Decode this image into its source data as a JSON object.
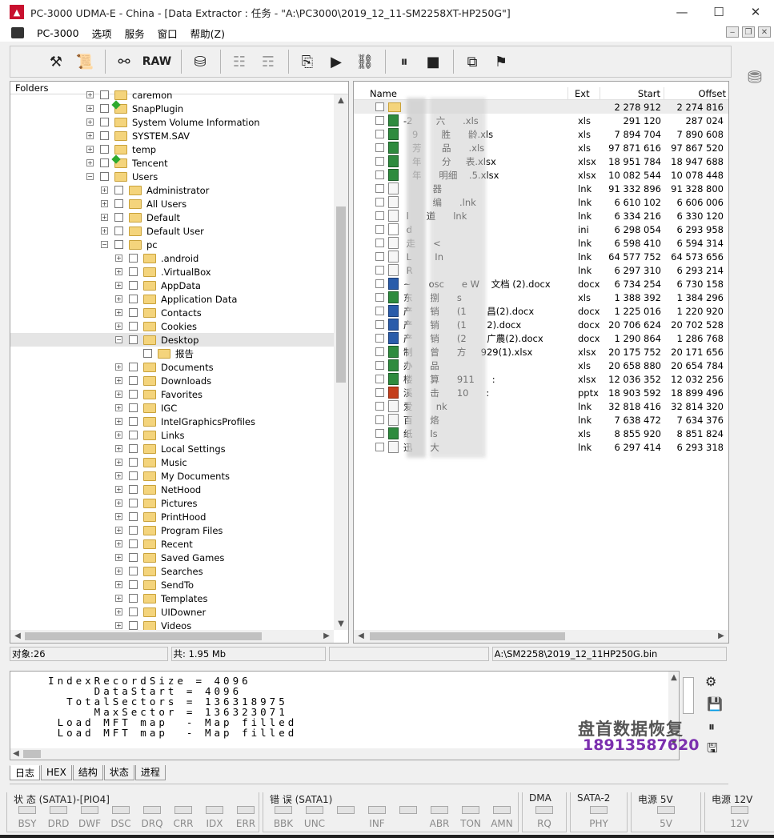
{
  "window": {
    "title": "PC-3000 UDMA-E - China - [Data Extractor : 任务 - \"A:\\PC3000\\2019_12_11-SM2258XT-HP250G\"]",
    "minimize": "—",
    "maximize": "☐",
    "close": "✕",
    "logo": "▲"
  },
  "menu": [
    "PC-3000",
    "选项",
    "服务",
    "窗口",
    "帮助(Z)"
  ],
  "mdi": [
    "‒",
    "❐",
    "✕"
  ],
  "toolbar": {
    "raw_label": "RAW",
    "icons": [
      "tools-icon",
      "scroll-icon",
      "binoculars-icon",
      "raw-icon",
      "disk-export-icon",
      "tree-icon",
      "tree-disabled-icon",
      "copy-check-icon",
      "play-icon",
      "network-icon",
      "pause-icon",
      "stop-icon",
      "windows-icon",
      "exit-icon"
    ]
  },
  "folders_panel": {
    "header": "Folders",
    "rows": [
      {
        "label": "caremon",
        "indent": 0,
        "exp": "+",
        "green": false
      },
      {
        "label": "SnapPlugin",
        "indent": 0,
        "exp": "+",
        "green": true
      },
      {
        "label": "System Volume Information",
        "indent": 0,
        "exp": "+",
        "green": false
      },
      {
        "label": "SYSTEM.SAV",
        "indent": 0,
        "exp": "+",
        "green": false
      },
      {
        "label": "temp",
        "indent": 0,
        "exp": "+",
        "green": false
      },
      {
        "label": "Tencent",
        "indent": 0,
        "exp": "+",
        "green": true
      },
      {
        "label": "Users",
        "indent": 0,
        "exp": "−",
        "green": false
      },
      {
        "label": "Administrator",
        "indent": 1,
        "exp": "+",
        "green": false
      },
      {
        "label": "All Users",
        "indent": 1,
        "exp": "+",
        "green": false
      },
      {
        "label": "Default",
        "indent": 1,
        "exp": "+",
        "green": false
      },
      {
        "label": "Default User",
        "indent": 1,
        "exp": "+",
        "green": false
      },
      {
        "label": "pc",
        "indent": 1,
        "exp": "−",
        "green": false
      },
      {
        "label": ".android",
        "indent": 2,
        "exp": "+",
        "green": false
      },
      {
        "label": ".VirtualBox",
        "indent": 2,
        "exp": "+",
        "green": false
      },
      {
        "label": "AppData",
        "indent": 2,
        "exp": "+",
        "green": false
      },
      {
        "label": "Application Data",
        "indent": 2,
        "exp": "+",
        "green": false
      },
      {
        "label": "Contacts",
        "indent": 2,
        "exp": "+",
        "green": false
      },
      {
        "label": "Cookies",
        "indent": 2,
        "exp": "+",
        "green": false
      },
      {
        "label": "Desktop",
        "indent": 2,
        "exp": "−",
        "green": false,
        "selected": true
      },
      {
        "label": "报告",
        "indent": 3,
        "exp": "",
        "green": false
      },
      {
        "label": "Documents",
        "indent": 2,
        "exp": "+",
        "green": false
      },
      {
        "label": "Downloads",
        "indent": 2,
        "exp": "+",
        "green": false
      },
      {
        "label": "Favorites",
        "indent": 2,
        "exp": "+",
        "green": false
      },
      {
        "label": "IGC",
        "indent": 2,
        "exp": "+",
        "green": false
      },
      {
        "label": "IntelGraphicsProfiles",
        "indent": 2,
        "exp": "+",
        "green": false
      },
      {
        "label": "Links",
        "indent": 2,
        "exp": "+",
        "green": false
      },
      {
        "label": "Local Settings",
        "indent": 2,
        "exp": "+",
        "green": false
      },
      {
        "label": "Music",
        "indent": 2,
        "exp": "+",
        "green": false
      },
      {
        "label": "My Documents",
        "indent": 2,
        "exp": "+",
        "green": false
      },
      {
        "label": "NetHood",
        "indent": 2,
        "exp": "+",
        "green": false
      },
      {
        "label": "Pictures",
        "indent": 2,
        "exp": "+",
        "green": false
      },
      {
        "label": "PrintHood",
        "indent": 2,
        "exp": "+",
        "green": false
      },
      {
        "label": "Program Files",
        "indent": 2,
        "exp": "+",
        "green": false
      },
      {
        "label": "Recent",
        "indent": 2,
        "exp": "+",
        "green": false
      },
      {
        "label": "Saved Games",
        "indent": 2,
        "exp": "+",
        "green": false
      },
      {
        "label": "Searches",
        "indent": 2,
        "exp": "+",
        "green": false
      },
      {
        "label": "SendTo",
        "indent": 2,
        "exp": "+",
        "green": false
      },
      {
        "label": "Templates",
        "indent": 2,
        "exp": "+",
        "green": false
      },
      {
        "label": "UIDowner",
        "indent": 2,
        "exp": "+",
        "green": false
      },
      {
        "label": "Videos",
        "indent": 2,
        "exp": "+",
        "green": false
      }
    ]
  },
  "files_panel": {
    "columns": [
      "Name",
      "Ext",
      "Start",
      "Offset"
    ],
    "rows": [
      {
        "name": "",
        "type": "folder",
        "ext": "",
        "start": "2 278 912",
        "offset": "2 274 816"
      },
      {
        "name": "-2        六      .xls",
        "type": "xls",
        "ext": "xls",
        "start": "291 120",
        "offset": "287 024"
      },
      {
        "name": "   9        胜      龄.xls",
        "type": "xls",
        "ext": "xls",
        "start": "7 894 704",
        "offset": "7 890 608"
      },
      {
        "name": "   芳       品      .xls",
        "type": "xls",
        "ext": "xls",
        "start": "97 871 616",
        "offset": "97 867 520"
      },
      {
        "name": "   年       分     表.xlsx",
        "type": "xls",
        "ext": "xlsx",
        "start": "18 951 784",
        "offset": "18 947 688"
      },
      {
        "name": "   年      明细    .5.xlsx",
        "type": "xls",
        "ext": "xlsx",
        "start": "10 082 544",
        "offset": "10 078 448"
      },
      {
        "name": "          器 ",
        "type": "lnk",
        "ext": "lnk",
        "start": "91 332 896",
        "offset": "91 328 800"
      },
      {
        "name": "          编      .lnk",
        "type": "lnk",
        "ext": "lnk",
        "start": "6 610 102",
        "offset": "6 606 006"
      },
      {
        "name": " l      道      lnk",
        "type": "lnk",
        "ext": "lnk",
        "start": "6 334 216",
        "offset": "6 330 120"
      },
      {
        "name": " d     ",
        "type": "ini",
        "ext": "ini",
        "start": "6 298 054",
        "offset": "6 293 958"
      },
      {
        "name": " 走      <",
        "type": "lnk",
        "ext": "lnk",
        "start": "6 598 410",
        "offset": "6 594 314"
      },
      {
        "name": " L        In",
        "type": "lnk",
        "ext": "lnk",
        "start": "64 577 752",
        "offset": "64 573 656"
      },
      {
        "name": " R       ",
        "type": "lnk",
        "ext": "lnk",
        "start": "6 297 310",
        "offset": "6 293 214"
      },
      {
        "name": "~      osc      e W    文档 (2).docx",
        "type": "doc",
        "ext": "docx",
        "start": "6 734 254",
        "offset": "6 730 158"
      },
      {
        "name": "东      捌      s",
        "type": "xls",
        "ext": "xls",
        "start": "1 388 392",
        "offset": "1 384 296"
      },
      {
        "name": "产      销      (1       昌(2).docx",
        "type": "doc",
        "ext": "docx",
        "start": "1 225 016",
        "offset": "1 220 920"
      },
      {
        "name": "产      销      (1       2).docx",
        "type": "doc",
        "ext": "docx",
        "start": "20 706 624",
        "offset": "20 702 528"
      },
      {
        "name": "产      销      (2       广農(2).docx",
        "type": "doc",
        "ext": "docx",
        "start": "1 290 864",
        "offset": "1 286 768"
      },
      {
        "name": "制      曾      方     929(1).xlsx",
        "type": "xls",
        "ext": "xlsx",
        "start": "20 175 752",
        "offset": "20 171 656"
      },
      {
        "name": "办      品      ",
        "type": "xls",
        "ext": "xls",
        "start": "20 658 880",
        "offset": "20 654 784"
      },
      {
        "name": "楼      算      911      :",
        "type": "xls",
        "ext": "xlsx",
        "start": "12 036 352",
        "offset": "12 032 256"
      },
      {
        "name": "溪      击      10      :",
        "type": "ppt",
        "ext": "pptx",
        "start": "18 903 592",
        "offset": "18 899 496"
      },
      {
        "name": "爱        nk",
        "type": "lnk",
        "ext": "lnk",
        "start": "32 818 416",
        "offset": "32 814 320"
      },
      {
        "name": "百      烙      ",
        "type": "lnk",
        "ext": "lnk",
        "start": "7 638 472",
        "offset": "7 634 376"
      },
      {
        "name": "纸      ls",
        "type": "xls",
        "ext": "xls",
        "start": "8 855 920",
        "offset": "8 851 824"
      },
      {
        "name": "迅      大      ",
        "type": "lnk",
        "ext": "lnk",
        "start": "6 297 414",
        "offset": "6 293 318"
      }
    ]
  },
  "status": {
    "objects": "对象:26",
    "total": "共: 1.95 Mb",
    "empty": "",
    "path": "A:\\SM2258\\2019_12_11HP250G.bin"
  },
  "log": {
    "lines": [
      "  IndexRecordSize = 4096",
      "       DataStart = 4096",
      "    TotalSectors = 136318975",
      "       MaxSector = 136323071",
      "   Load MFT map  - Map filled",
      "   Load MFT map  - Map filled"
    ]
  },
  "tabs": [
    "日志",
    "HEX",
    "结构",
    "状态",
    "进程"
  ],
  "watermark": {
    "line1": "盘首数据恢复",
    "line2": "18913587620"
  },
  "registers": {
    "groups": [
      {
        "label": "状 态 (SATA1)-[PIO4]",
        "regs": [
          "BSY",
          "DRD",
          "DWF",
          "DSC",
          "DRQ",
          "CRR",
          "IDX",
          "ERR"
        ]
      },
      {
        "label": "错 误 (SATA1)",
        "regs": [
          "BBK",
          "UNC",
          "",
          "INF",
          "",
          "ABR",
          "TON",
          "AMN"
        ]
      },
      {
        "label": "DMA",
        "regs": [
          "RQ"
        ]
      },
      {
        "label": "SATA-2",
        "regs": [
          "PHY"
        ]
      },
      {
        "label": "电源 5V",
        "regs": [
          "5V"
        ]
      },
      {
        "label": "电源 12V",
        "regs": [
          "12V"
        ]
      }
    ]
  }
}
